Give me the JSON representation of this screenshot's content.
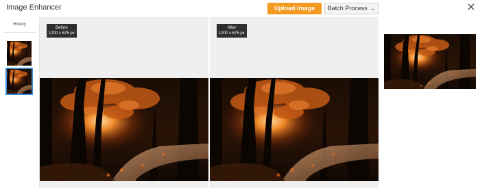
{
  "header": {
    "title": "Image Enhancer",
    "upload_label": "Upload Image",
    "batch_label": "Batch Process →",
    "close_icon": "close-icon",
    "accent_color": "#f39a20"
  },
  "sidebar": {
    "title": "History",
    "items": [
      {
        "name": "history-thumbnail-1",
        "selected": false
      },
      {
        "name": "history-thumbnail-2",
        "selected": true
      }
    ]
  },
  "before": {
    "label": "Before",
    "size": "1200 x 675 px"
  },
  "after": {
    "label": "After",
    "size": "1200 x 675 px"
  }
}
